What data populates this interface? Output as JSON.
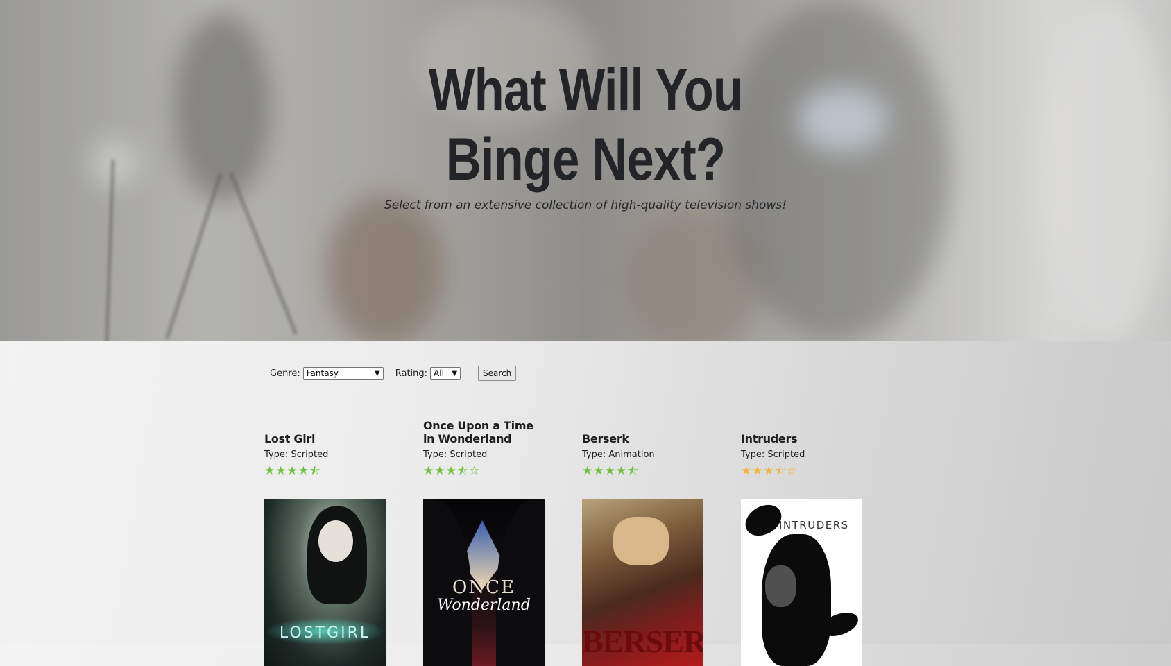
{
  "hero": {
    "title_line1": "What Will You",
    "title_line2": "Binge Next?",
    "subtitle": "Select from an extensive collection of high-quality television shows!"
  },
  "filters": {
    "genre_label": "Genre:",
    "genre_value": "Fantasy",
    "rating_label": "Rating:",
    "rating_value": "All",
    "search_label": "Search"
  },
  "shows": [
    {
      "title": "Lost Girl",
      "type": "Type: Scripted",
      "rating": 4.5,
      "star_color": "#6fc13b",
      "stars": "★★★★⯪",
      "poster_text": "LOSTGIRL"
    },
    {
      "title": "Once Upon a Time in Wonderland",
      "type": "Type: Scripted",
      "rating": 3.5,
      "star_color": "#6fc13b",
      "stars": "★★★⯪☆",
      "poster_text_1": "ONCE",
      "poster_text_2": "Wonderland"
    },
    {
      "title": "Berserk",
      "type": "Type: Animation",
      "rating": 4.5,
      "star_color": "#6fc13b",
      "stars": "★★★★⯪",
      "poster_text": "BERSERK"
    },
    {
      "title": "Intruders",
      "type": "Type: Scripted",
      "rating": 3.5,
      "star_color": "#f2b437",
      "stars": "★★★⯪☆",
      "poster_text": "INTRUDERS"
    }
  ]
}
